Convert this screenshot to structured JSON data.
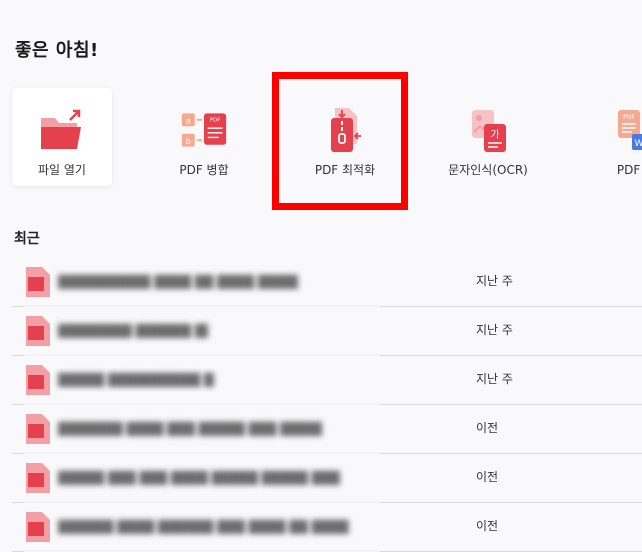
{
  "greeting": "좋은 아침!",
  "tools": [
    {
      "label": "파일 열기",
      "icon": "folder-open-icon"
    },
    {
      "label": "PDF 병합",
      "icon": "pdf-merge-icon"
    },
    {
      "label": "PDF 최적화",
      "icon": "pdf-compress-icon"
    },
    {
      "label": "문자인식(OCR)",
      "icon": "ocr-icon"
    },
    {
      "label": "PDF 변",
      "icon": "pdf-convert-icon"
    }
  ],
  "recent": {
    "title": "최근",
    "files": [
      {
        "name": "██████████ ████ ██ ████ █████ ███",
        "date": "지난 주"
      },
      {
        "name": "████████ ██████ ████",
        "date": "지난 주"
      },
      {
        "name": "█████ ██████████ ████",
        "date": "지난 주"
      },
      {
        "name": "███████ ████ ███ █████ ███ █████ ███",
        "date": "이전"
      },
      {
        "name": "█████ ███ ███ ████ █████ █████ ████",
        "date": "이전"
      },
      {
        "name": "██████ ████ ██████ ███ ████ ██ ████",
        "date": "이전"
      }
    ]
  },
  "colors": {
    "accent": "#e5404d",
    "highlight": "#ff0000",
    "background": "#f9f9fb"
  }
}
